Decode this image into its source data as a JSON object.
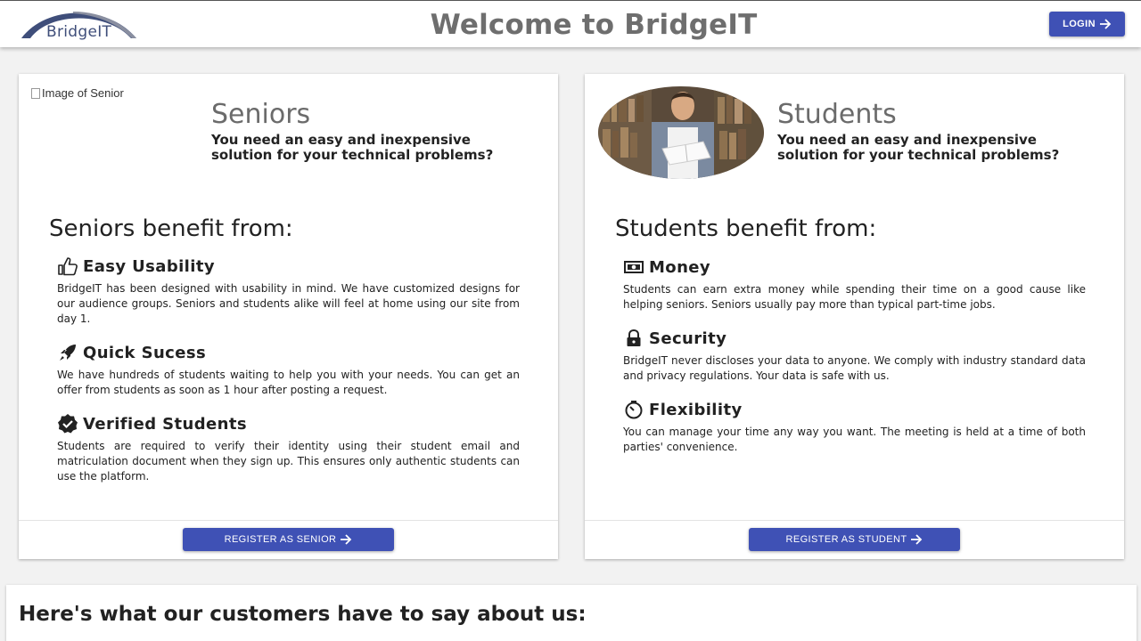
{
  "header": {
    "logo_text": "BridgeIT",
    "title": "Welcome to BridgeIT",
    "login_label": "LOGIN"
  },
  "senior_card": {
    "image_alt": "Image of Senior",
    "title": "Seniors",
    "subtitle": "You need an easy and inexpensive solution for your technical problems?",
    "benefit_heading": "Seniors benefit from:",
    "features": [
      {
        "icon": "thumbs-up-icon",
        "title": "Easy Usability",
        "text": "BridgeIT has been designed with usability in mind. We have customized designs for our audience groups. Seniors and students alike will feel at home using our site from day 1."
      },
      {
        "icon": "rocket-icon",
        "title": "Quick Sucess",
        "text": "We have hundreds of students waiting to help you with your needs. You can get an offer from students as soon as 1 hour after posting a request."
      },
      {
        "icon": "verified-icon",
        "title": "Verified Students",
        "text": "Students are required to verify their identity using their student email and matriculation document when they sign up. This ensures only authentic students can use the platform."
      }
    ],
    "register_label": "REGISTER AS SENIOR"
  },
  "student_card": {
    "title": "Students",
    "subtitle": "You need an easy and inexpensive solution for your technical problems?",
    "benefit_heading": "Students benefit from:",
    "features": [
      {
        "icon": "money-icon",
        "title": "Money",
        "text": "Students can earn extra money while spending their time on a good cause like helping seniors. Seniors usually pay more than typical part-time jobs."
      },
      {
        "icon": "lock-icon",
        "title": "Security",
        "text": "BridgeIT never discloses your data to anyone. We comply with industry standard data and privacy regulations. Your data is safe with us."
      },
      {
        "icon": "timer-icon",
        "title": "Flexibility",
        "text": "You can manage your time any way you want. The meeting is held at a time of both parties' convenience."
      }
    ],
    "register_label": "REGISTER AS STUDENT"
  },
  "testimonials": {
    "title": "Here's what our customers have to say about us:"
  },
  "colors": {
    "primary": "#3f51b5",
    "logo_arc": "#3f4e7a",
    "title_gray": "#6e6e6e"
  }
}
